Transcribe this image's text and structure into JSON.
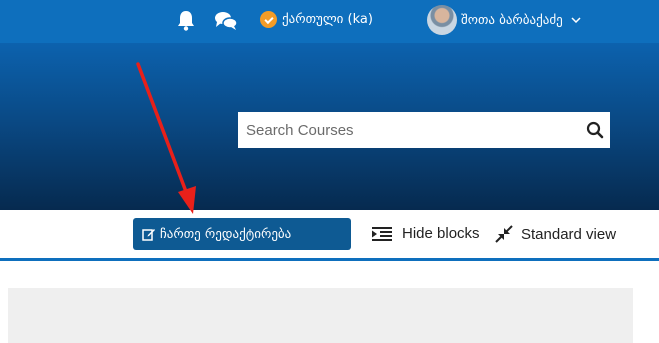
{
  "navbar": {
    "bell_icon": "bell-icon",
    "chat_icon": "chat-bubbles-icon",
    "language": {
      "label": "ქართული (ka)",
      "icon": "language-badge-icon",
      "icon_color": "#f39c27"
    },
    "user": {
      "name": "შოთა ბარბაქაძე",
      "avatar": "user-avatar"
    },
    "color": "#0e6fbd"
  },
  "hero": {
    "search": {
      "placeholder": "Search Courses",
      "value": "",
      "button_icon": "search-icon"
    }
  },
  "toolbar": {
    "edit_button_label": "ჩართე რედაქტირება",
    "edit_button_icon": "edit-icon",
    "edit_button_color": "#0e5a93",
    "hide_blocks_label": "Hide blocks",
    "hide_blocks_icon": "indent-icon",
    "standard_view_label": "Standard view",
    "standard_view_icon": "compress-icon"
  },
  "annotation": {
    "arrow_color": "#e8201a"
  }
}
